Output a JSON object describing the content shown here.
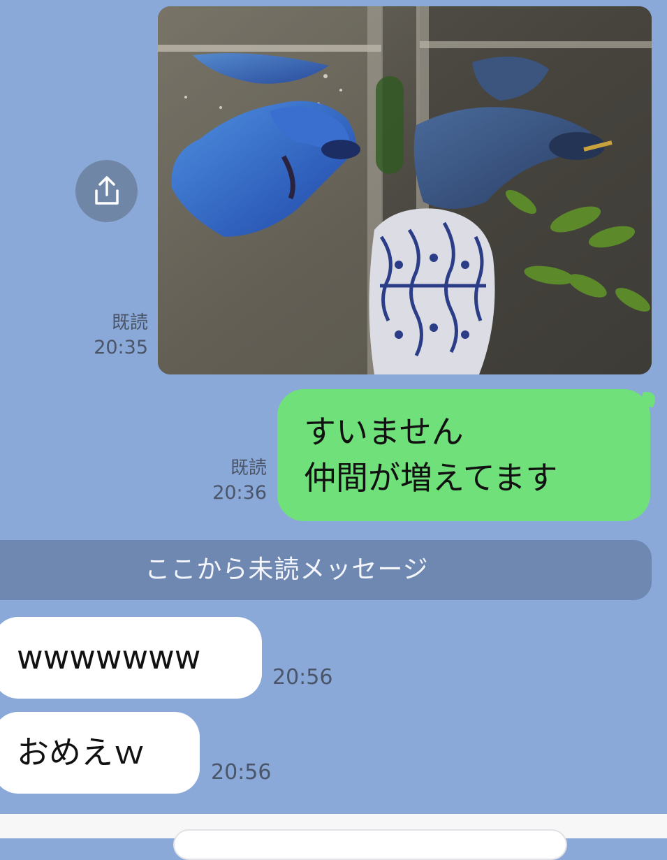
{
  "messages": {
    "photo": {
      "read_label": "既読",
      "time": "20:35",
      "share_icon": "share-icon",
      "subject": "betta-fish-aquarium-photo"
    },
    "outgoing_text": {
      "text": "すいません\n仲間が増えてます",
      "read_label": "既読",
      "time": "20:36"
    },
    "unread_divider": "ここから未読メッセージ",
    "incoming": [
      {
        "text": "wwwwwww",
        "time": "20:56"
      },
      {
        "text": "おめえｗ",
        "time": "20:56"
      }
    ]
  },
  "colors": {
    "chat_background": "#8aa9d8",
    "outgoing_bubble": "#70e07a",
    "incoming_bubble": "#ffffff",
    "divider": "#6e88b2"
  }
}
